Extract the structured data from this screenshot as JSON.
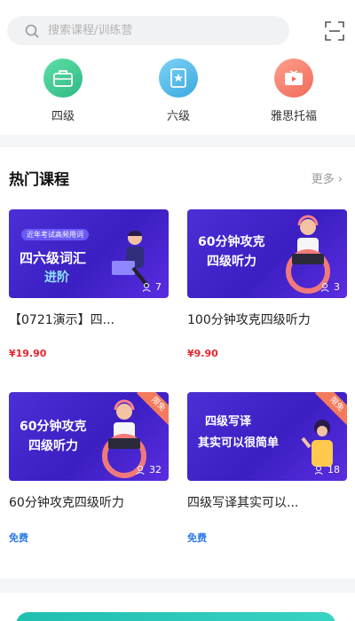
{
  "search": {
    "placeholder": "搜索课程/训练营"
  },
  "categories": [
    {
      "label": "四级",
      "icon": "briefcase-icon",
      "color": "#3ccf93"
    },
    {
      "label": "六级",
      "icon": "certificate-icon",
      "color": "#4bb7ea"
    },
    {
      "label": "雅思托福",
      "icon": "video-play-icon",
      "color": "#f47c6b"
    }
  ],
  "section": {
    "title": "热门课程",
    "more": "更多 ›"
  },
  "courses": [
    {
      "banner_tag": "近年考试高频用词",
      "banner_line1": "四六级词汇",
      "banner_line2": "进阶",
      "count": "7",
      "title": "【0721演示】四...",
      "price": "¥19.90",
      "badge": ""
    },
    {
      "banner_line1": "60分钟攻克",
      "banner_line2": "四级听力",
      "count": "3",
      "title": "100分钟攻克四级听力",
      "price": "¥9.90",
      "badge": ""
    },
    {
      "banner_line1": "60分钟攻克",
      "banner_line2": "四级听力",
      "count": "32",
      "title": "60分钟攻克四级听力",
      "price": "免费",
      "badge": "限免"
    },
    {
      "banner_line1": "四级写译",
      "banner_line2": "其实可以很简单",
      "count": "18",
      "title": "四级写译其实可以...",
      "price": "免费",
      "badge": "限免"
    }
  ],
  "colors": {
    "price_paid": "#e6262d",
    "price_free": "#2d7be5",
    "banner": "#4c2fd6"
  }
}
